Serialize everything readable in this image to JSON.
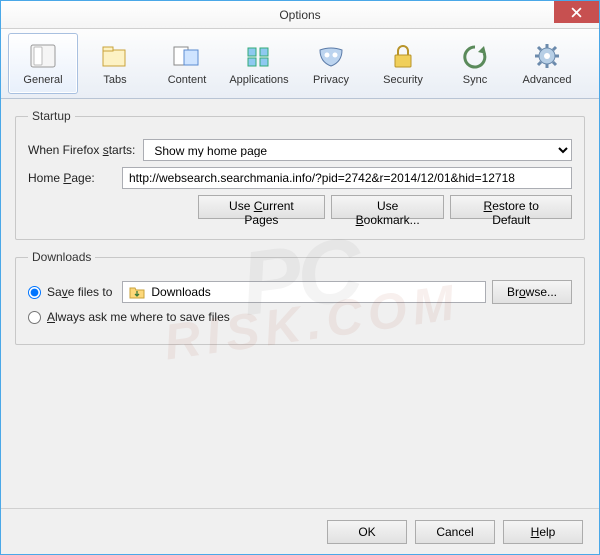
{
  "window": {
    "title": "Options"
  },
  "toolbar": {
    "items": [
      {
        "label": "General"
      },
      {
        "label": "Tabs"
      },
      {
        "label": "Content"
      },
      {
        "label": "Applications"
      },
      {
        "label": "Privacy"
      },
      {
        "label": "Security"
      },
      {
        "label": "Sync"
      },
      {
        "label": "Advanced"
      }
    ]
  },
  "startup": {
    "legend": "Startup",
    "when_label_pre": "When Firefox ",
    "when_label_key": "s",
    "when_label_post": "tarts:",
    "when_value": "Show my home page",
    "home_label_pre": "Home ",
    "home_label_key": "P",
    "home_label_post": "age:",
    "home_value": "http://websearch.searchmania.info/?pid=2742&r=2014/12/01&hid=12718",
    "btn_current_pre": "Use ",
    "btn_current_key": "C",
    "btn_current_post": "urrent Pages",
    "btn_bookmark_pre": "Use ",
    "btn_bookmark_key": "B",
    "btn_bookmark_post": "ookmark...",
    "btn_restore_key": "R",
    "btn_restore_post": "estore to Default"
  },
  "downloads": {
    "legend": "Downloads",
    "save_label_pre": "Sa",
    "save_label_key": "v",
    "save_label_post": "e files to",
    "save_path": "Downloads",
    "browse_pre": "Br",
    "browse_key": "o",
    "browse_post": "wse...",
    "always_key": "A",
    "always_post": "lways ask me where to save files"
  },
  "footer": {
    "ok": "OK",
    "cancel": "Cancel",
    "help_key": "H",
    "help_post": "elp"
  },
  "watermark": {
    "line1": "PC",
    "line2": "RISK.COM"
  }
}
